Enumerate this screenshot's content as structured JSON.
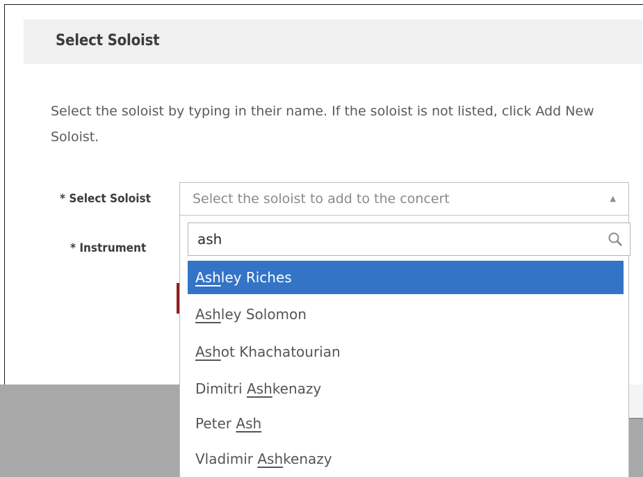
{
  "dialog": {
    "title": "Select Soloist",
    "instructions": "Select the soloist by typing in their name. If the soloist is not listed, click Add New Soloist."
  },
  "form": {
    "soloist_label": "* Select Soloist",
    "instrument_label": "* Instrument",
    "select_placeholder": "Select the soloist to add to the concert"
  },
  "dropdown": {
    "search_value": "ash",
    "options": [
      {
        "match": "Ash",
        "before": "",
        "after": "ley Riches",
        "highlighted": true
      },
      {
        "match": "Ash",
        "before": "",
        "after": "ley Solomon",
        "highlighted": false
      },
      {
        "match": "Ash",
        "before": "",
        "after": "ot Khachatourian",
        "highlighted": false
      },
      {
        "match": "Ash",
        "before": "Dimitri ",
        "after": "kenazy",
        "highlighted": false
      },
      {
        "match": "Ash",
        "before": "Peter ",
        "after": "",
        "highlighted": false
      },
      {
        "match": "Ash",
        "before": "Vladimir ",
        "after": "kenazy",
        "highlighted": false
      }
    ]
  },
  "icons": {
    "select_arrow": "caret-up-icon",
    "search": "search-icon"
  },
  "colors": {
    "highlight": "#3374c6",
    "header_bg": "#f0f0f0"
  }
}
